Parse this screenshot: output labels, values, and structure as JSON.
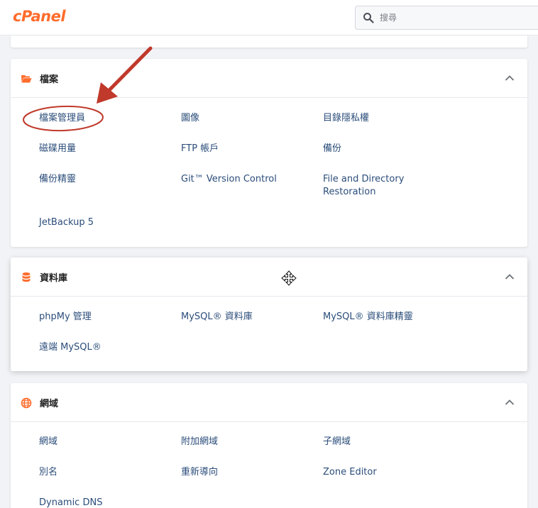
{
  "header": {
    "logo": "cPanel",
    "search_placeholder": "搜尋"
  },
  "sections": {
    "files": {
      "title": "檔案",
      "items": [
        "檔案管理員",
        "圖像",
        "目錄隱私權",
        "磁碟用量",
        "FTP 帳戶",
        "備份",
        "備份精靈",
        "Git™ Version Control",
        "File and Directory Restoration",
        "JetBackup 5"
      ]
    },
    "databases": {
      "title": "資料庫",
      "items": [
        "phpMy 管理",
        "MySQL® 資料庫",
        "MySQL® 資料庫精靈",
        "遠端 MySQL®"
      ]
    },
    "domains": {
      "title": "網域",
      "items": [
        "網域",
        "附加網域",
        "子網域",
        "別名",
        "重新導向",
        "Zone Editor",
        "Dynamic DNS"
      ]
    }
  },
  "colors": {
    "accent": "#ff6c2c",
    "link": "#2b4d7a",
    "annotation": "#c0392b"
  },
  "icons": [
    "search-icon",
    "folder-open-icon",
    "database-icon",
    "globe-icon",
    "chevron-up-icon",
    "move-cursor-icon"
  ]
}
